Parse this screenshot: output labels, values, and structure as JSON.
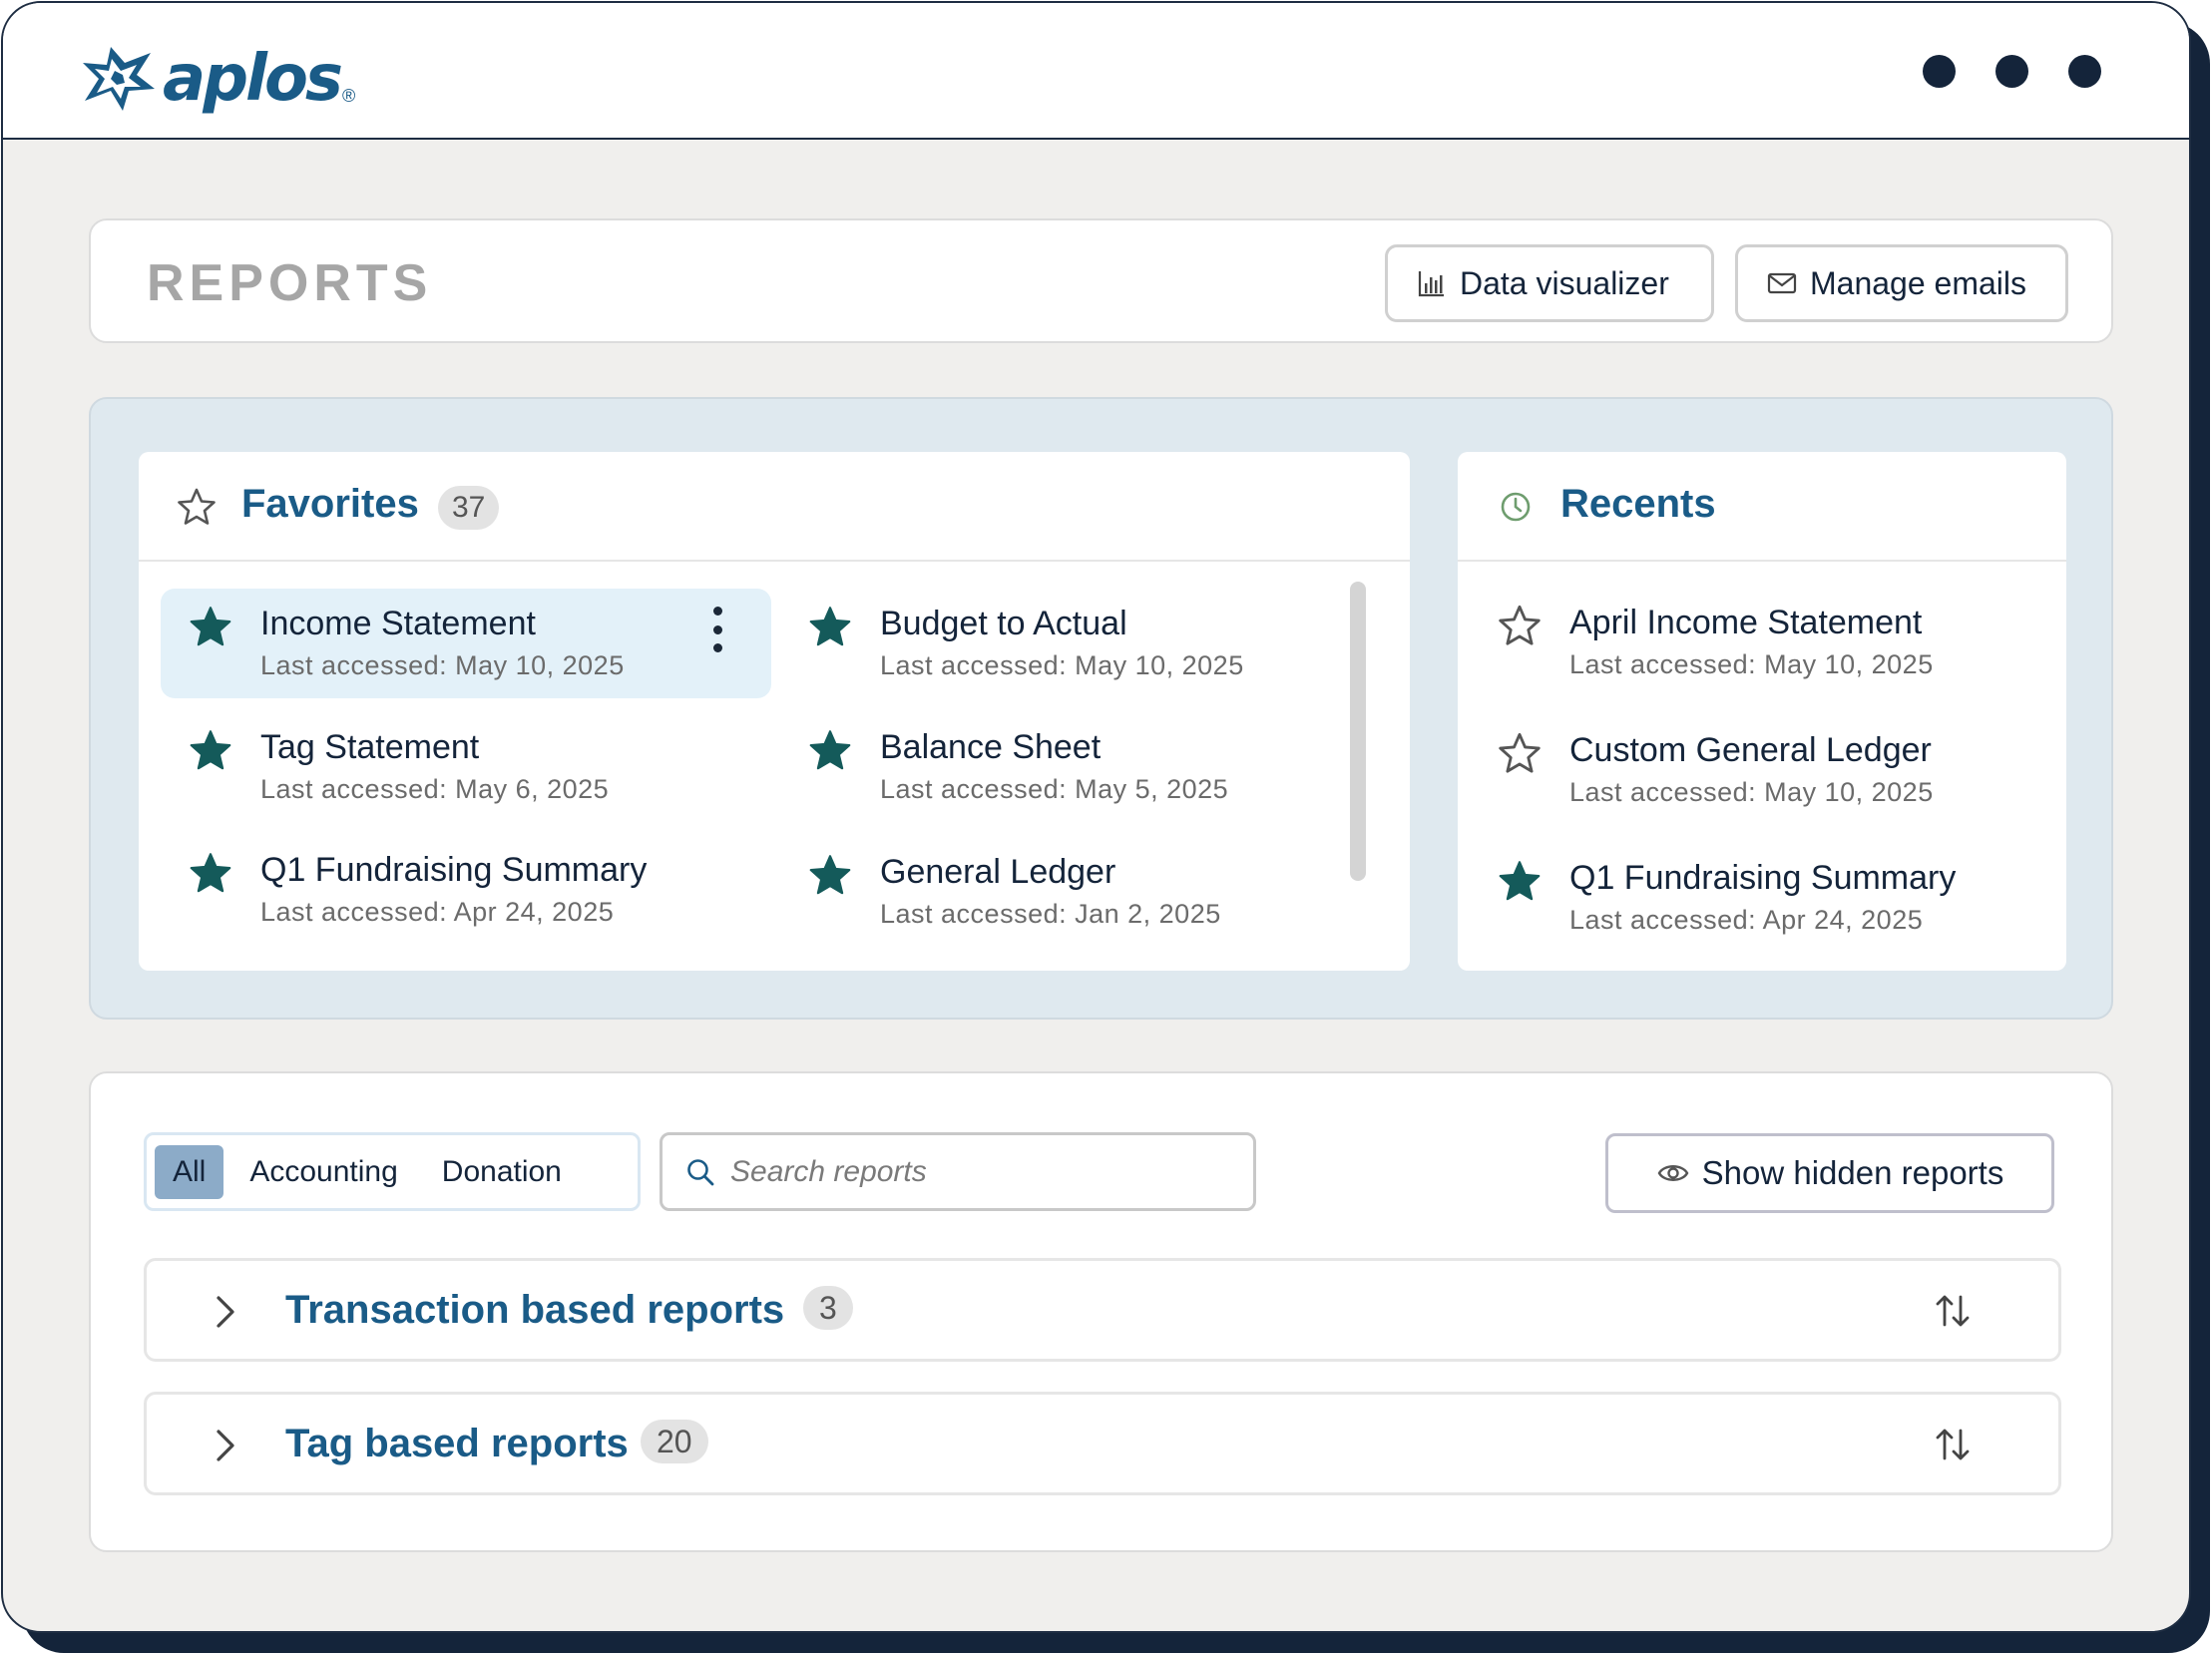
{
  "app": {
    "logo_text": "aplos",
    "logo_registered": "®",
    "window_controls": [
      "dot",
      "dot",
      "dot"
    ]
  },
  "header": {
    "title": "REPORTS",
    "data_visualizer_label": "Data visualizer",
    "manage_emails_label": "Manage emails"
  },
  "favorites": {
    "title": "Favorites",
    "count": "37",
    "items": [
      {
        "name": "Income Statement",
        "meta": "Last accessed: May 10, 2025",
        "starred": true
      },
      {
        "name": "Budget to Actual",
        "meta": "Last accessed: May 10, 2025",
        "starred": true
      },
      {
        "name": "Tag Statement",
        "meta": "Last accessed: May 6, 2025",
        "starred": true
      },
      {
        "name": "Balance Sheet",
        "meta": "Last accessed: May 5, 2025",
        "starred": true
      },
      {
        "name": "Q1 Fundraising Summary",
        "meta": "Last accessed: Apr 24, 2025",
        "starred": true
      },
      {
        "name": "General Ledger",
        "meta": "Last accessed: Jan 2, 2025",
        "starred": true
      }
    ]
  },
  "recents": {
    "title": "Recents",
    "items": [
      {
        "name": "April Income Statement",
        "meta": "Last accessed: May 10, 2025",
        "starred": false
      },
      {
        "name": "Custom General Ledger",
        "meta": "Last accessed: May 10, 2025",
        "starred": false
      },
      {
        "name": "Q1 Fundraising Summary",
        "meta": "Last accessed: Apr 24, 2025",
        "starred": true
      }
    ]
  },
  "filters": {
    "tabs": [
      "All",
      "Accounting",
      "Donation"
    ],
    "active": "All",
    "search_placeholder": "Search reports",
    "show_hidden_label": "Show hidden reports"
  },
  "sections": [
    {
      "title": "Transaction based reports",
      "count": "3"
    },
    {
      "title": "Tag based reports",
      "count": "20"
    }
  ],
  "colors": {
    "brand": "#1a5b87",
    "star_filled": "#145a5a",
    "navy": "#14243a",
    "panel_blue": "#dfe9ef",
    "active_filter": "#8cabc8",
    "active_item": "#e3f1f9"
  }
}
